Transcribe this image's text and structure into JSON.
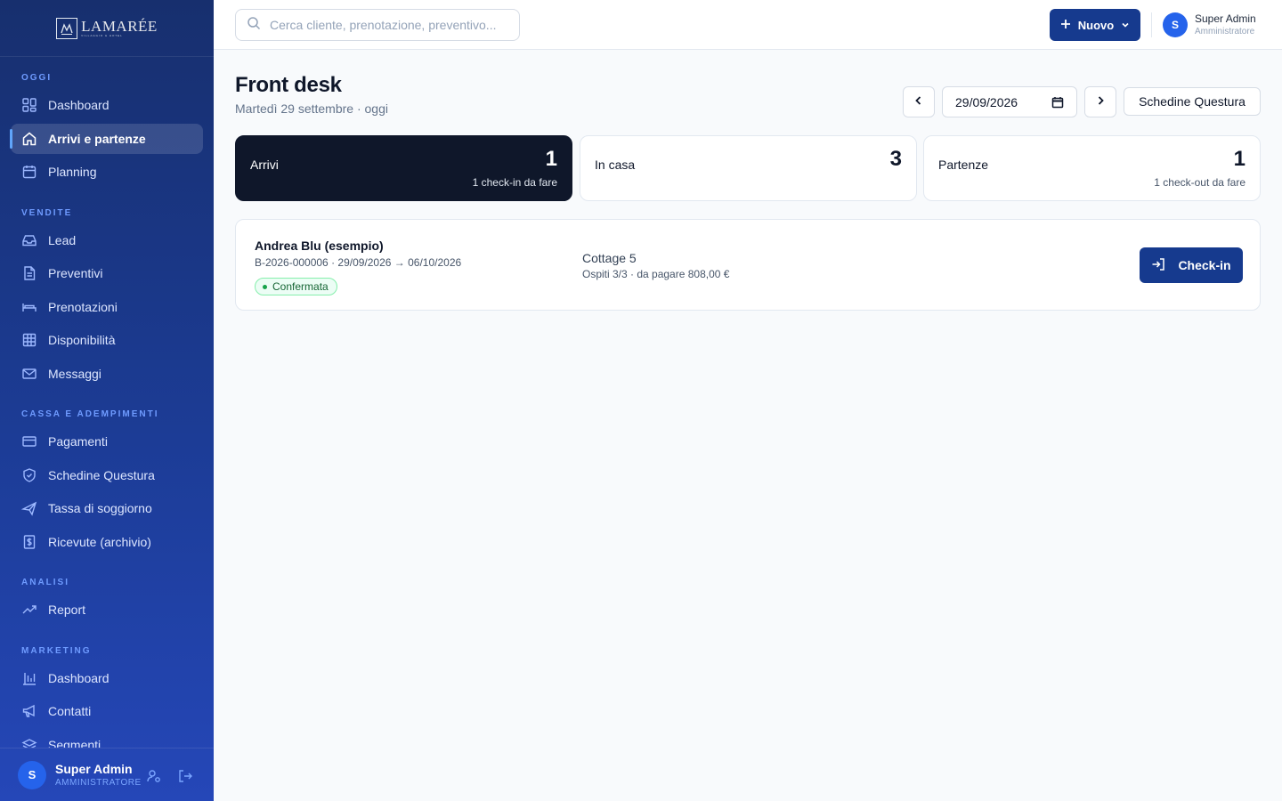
{
  "brand": {
    "logo_text": "LAMARÉE",
    "logo_subtext": "VILLAGGIO & HOTEL"
  },
  "search": {
    "placeholder": "Cerca cliente, prenotazione, preventivo..."
  },
  "topbar": {
    "new_button": "Nuovo",
    "user_name": "Super Admin",
    "user_role": "Amministratore",
    "avatar_initial": "S"
  },
  "sidebar": {
    "sections": [
      {
        "title": "OGGI",
        "items": [
          {
            "label": "Dashboard",
            "icon": "grid-icon"
          },
          {
            "label": "Arrivi e partenze",
            "icon": "home-icon",
            "active": true
          },
          {
            "label": "Planning",
            "icon": "calendar-icon"
          }
        ]
      },
      {
        "title": "VENDITE",
        "items": [
          {
            "label": "Lead",
            "icon": "inbox-icon"
          },
          {
            "label": "Preventivi",
            "icon": "document-icon"
          },
          {
            "label": "Prenotazioni",
            "icon": "bed-icon"
          },
          {
            "label": "Disponibilità",
            "icon": "table-icon"
          },
          {
            "label": "Messaggi",
            "icon": "mail-icon"
          }
        ]
      },
      {
        "title": "CASSA E ADEMPIMENTI",
        "items": [
          {
            "label": "Pagamenti",
            "icon": "credit-card-icon"
          },
          {
            "label": "Schedine Questura",
            "icon": "shield-icon"
          },
          {
            "label": "Tassa di soggiorno",
            "icon": "plane-icon"
          },
          {
            "label": "Ricevute (archivio)",
            "icon": "receipt-icon"
          }
        ]
      },
      {
        "title": "ANALISI",
        "items": [
          {
            "label": "Report",
            "icon": "trending-up-icon"
          }
        ]
      },
      {
        "title": "MARKETING",
        "items": [
          {
            "label": "Dashboard",
            "icon": "bar-chart-icon"
          },
          {
            "label": "Contatti",
            "icon": "megaphone-icon"
          },
          {
            "label": "Segmenti",
            "icon": "layers-icon"
          }
        ]
      }
    ],
    "footer": {
      "avatar_initial": "S",
      "name": "Super Admin",
      "role": "AMMINISTRATORE"
    }
  },
  "page": {
    "title": "Front desk",
    "subtitle": "Martedì 29 settembre · oggi",
    "date_value": "29/09/2026",
    "questura_button": "Schedine Questura"
  },
  "stats": [
    {
      "label": "Arrivi",
      "value": "1",
      "sub": "1 check-in da fare",
      "selected": true
    },
    {
      "label": "In casa",
      "value": "3",
      "sub": ""
    },
    {
      "label": "Partenze",
      "value": "1",
      "sub": "1 check-out da fare"
    }
  ],
  "bookings": [
    {
      "guest": "Andrea Blu (esempio)",
      "reference": "B-2026-000006 · 29/09/2026 → 06/10/2026",
      "status": "Confermata",
      "unit": "Cottage 5",
      "details": "Ospiti 3/3 · da pagare 808,00 €",
      "action": "Check-in"
    }
  ],
  "colors": {
    "sidebar_top": "#172f6e",
    "sidebar_bottom": "#2547b8",
    "primary": "#163a8e",
    "dark_card": "#0f172a",
    "status_green": "#16a34a"
  }
}
